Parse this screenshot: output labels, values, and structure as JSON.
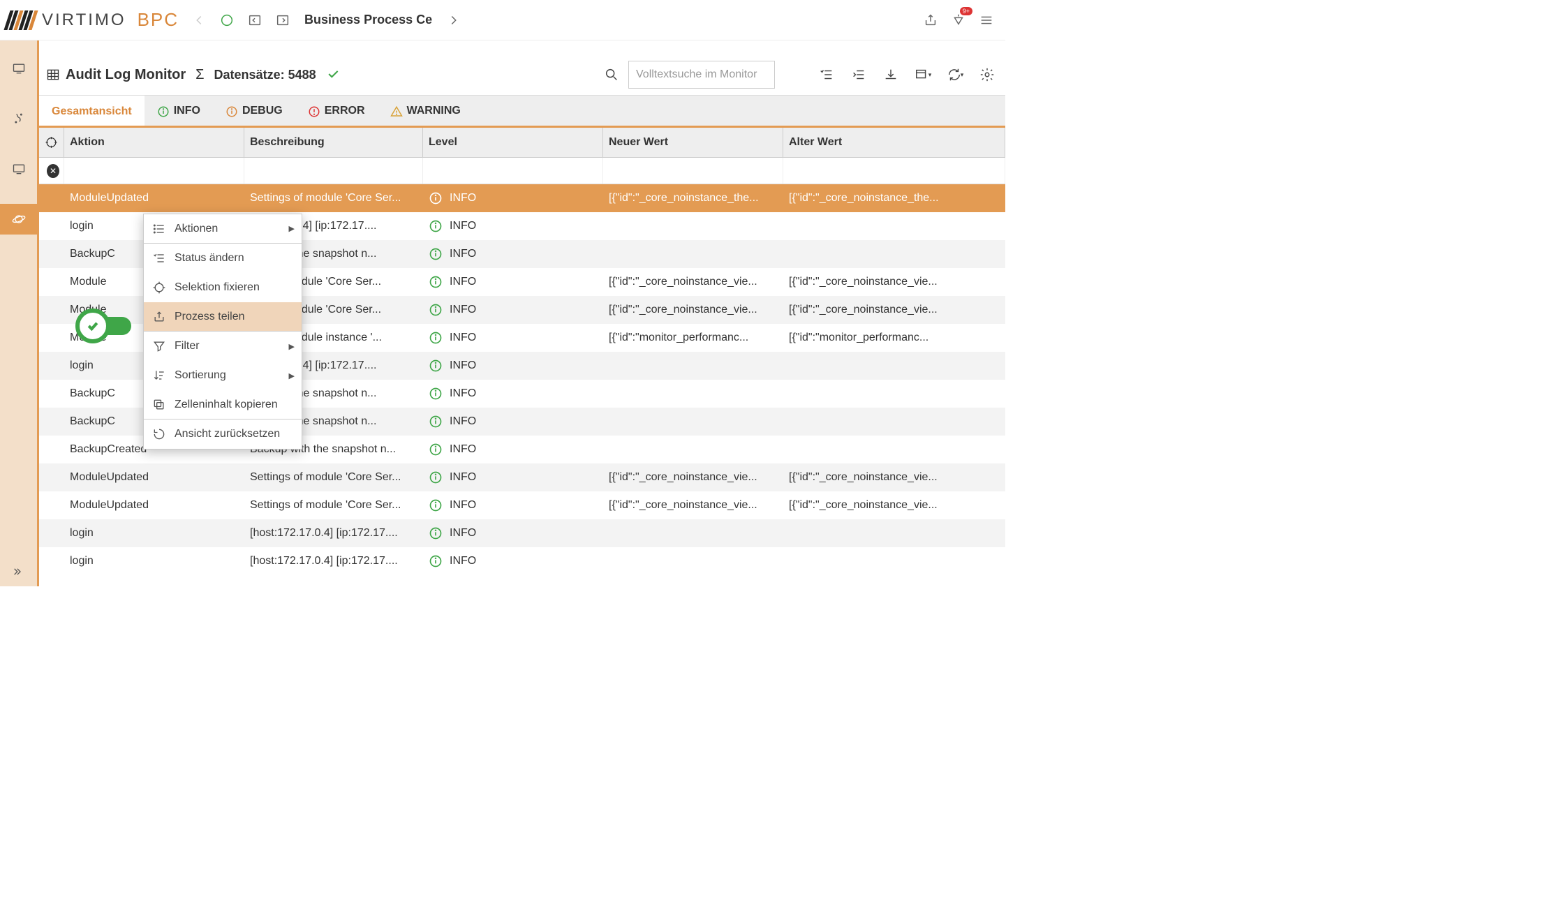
{
  "header": {
    "brand_a": "VIRTIMO",
    "brand_b": "BPC",
    "breadcrumb": "Business Process Ce",
    "notification_badge": "9+"
  },
  "content_header": {
    "title": "Audit Log Monitor",
    "count_label": "Datensätze: 5488",
    "search_placeholder": "Volltextsuche im Monitor"
  },
  "tabs": {
    "t0": "Gesamtansicht",
    "t1": "INFO",
    "t2": "DEBUG",
    "t3": "ERROR",
    "t4": "WARNING"
  },
  "columns": {
    "c1": "Aktion",
    "c2": "Beschreibung",
    "c3": "Level",
    "c4": "Neuer Wert",
    "c5": "Alter Wert"
  },
  "level_label": "INFO",
  "rows": [
    {
      "aktion": "ModuleUpdated",
      "besch": "Settings of module 'Core Ser...",
      "neuer": "[{\"id\":\"_core_noinstance_the...",
      "alter": "[{\"id\":\"_core_noinstance_the...",
      "sel": true,
      "odd": false
    },
    {
      "aktion": "login",
      "besch": "t:172.17.0.4] [ip:172.17....",
      "neuer": "",
      "alter": "",
      "odd": false
    },
    {
      "aktion": "BackupC",
      "besch": "kup with the snapshot n...",
      "neuer": "",
      "alter": "",
      "odd": true
    },
    {
      "aktion": "Module",
      "besch": "ings of module 'Core Ser...",
      "neuer": "[{\"id\":\"_core_noinstance_vie...",
      "alter": "[{\"id\":\"_core_noinstance_vie...",
      "odd": false
    },
    {
      "aktion": "Module",
      "besch": "ings of module 'Core Ser...",
      "neuer": "[{\"id\":\"_core_noinstance_vie...",
      "alter": "[{\"id\":\"_core_noinstance_vie...",
      "odd": true
    },
    {
      "aktion": "Module",
      "besch": "ings of module instance '...",
      "neuer": "[{\"id\":\"monitor_performanc...",
      "alter": "[{\"id\":\"monitor_performanc...",
      "odd": false
    },
    {
      "aktion": "login",
      "besch": "t:172.17.0.4] [ip:172.17....",
      "neuer": "",
      "alter": "",
      "odd": true
    },
    {
      "aktion": "BackupC",
      "besch": "kup with the snapshot n...",
      "neuer": "",
      "alter": "",
      "odd": false
    },
    {
      "aktion": "BackupC",
      "besch": "kup with the snapshot n...",
      "neuer": "",
      "alter": "",
      "odd": true
    },
    {
      "aktion": "BackupCreated",
      "besch": "Backup with the snapshot n...",
      "neuer": "",
      "alter": "",
      "odd": false
    },
    {
      "aktion": "ModuleUpdated",
      "besch": "Settings of module 'Core Ser...",
      "neuer": "[{\"id\":\"_core_noinstance_vie...",
      "alter": "[{\"id\":\"_core_noinstance_vie...",
      "odd": true
    },
    {
      "aktion": "ModuleUpdated",
      "besch": "Settings of module 'Core Ser...",
      "neuer": "[{\"id\":\"_core_noinstance_vie...",
      "alter": "[{\"id\":\"_core_noinstance_vie...",
      "odd": false
    },
    {
      "aktion": "login",
      "besch": "[host:172.17.0.4] [ip:172.17....",
      "neuer": "",
      "alter": "",
      "odd": true
    },
    {
      "aktion": "login",
      "besch": "[host:172.17.0.4] [ip:172.17....",
      "neuer": "",
      "alter": "",
      "odd": false
    }
  ],
  "ctx": {
    "aktionen": "Aktionen",
    "status": "Status ändern",
    "selektion": "Selektion fixieren",
    "prozess": "Prozess teilen",
    "filter": "Filter",
    "sortierung": "Sortierung",
    "zellen": "Zelleninhalt kopieren",
    "ansicht": "Ansicht zurücksetzen"
  }
}
